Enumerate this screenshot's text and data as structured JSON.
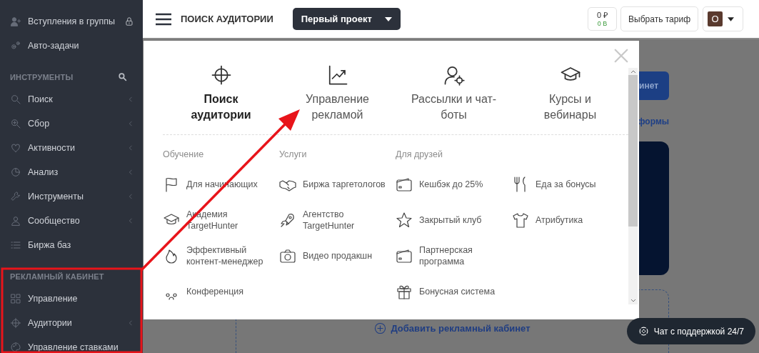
{
  "sidebar": {
    "items": [
      {
        "kind": "link",
        "label": "Вступления в группы",
        "has_submenu": false,
        "locked": true
      },
      {
        "kind": "link",
        "label": "Авто-задачи",
        "has_submenu": false,
        "locked": false
      },
      {
        "kind": "section",
        "label": "ИНСТРУМЕНТЫ",
        "searchable": true
      },
      {
        "kind": "link",
        "label": "Поиск",
        "has_submenu": true,
        "locked": false
      },
      {
        "kind": "link",
        "label": "Сбор",
        "has_submenu": true,
        "locked": false
      },
      {
        "kind": "link",
        "label": "Активности",
        "has_submenu": true,
        "locked": false
      },
      {
        "kind": "link",
        "label": "Анализ",
        "has_submenu": true,
        "locked": false
      },
      {
        "kind": "link",
        "label": "Инструменты",
        "has_submenu": true,
        "locked": false
      },
      {
        "kind": "link",
        "label": "Сообщество",
        "has_submenu": true,
        "locked": false
      },
      {
        "kind": "link",
        "label": "Биржа баз",
        "has_submenu": false,
        "locked": false
      },
      {
        "kind": "section",
        "label": "РЕКЛАМНЫЙ КАБИНЕТ",
        "searchable": false
      },
      {
        "kind": "link",
        "label": "Управление",
        "has_submenu": false,
        "locked": false
      },
      {
        "kind": "link",
        "label": "Аудитории",
        "has_submenu": true,
        "locked": false
      },
      {
        "kind": "link",
        "label": "Управление ставками",
        "has_submenu": false,
        "locked": false
      }
    ]
  },
  "header": {
    "page_title": "ПОИСК АУДИТОРИИ",
    "project": "Первый проект",
    "balance": "0 ₽",
    "bonus": "0 B",
    "tariff_button": "Выбрать тариф",
    "avatar_letter": "О"
  },
  "background": {
    "button_fragment": "инет",
    "link_fragment": "формы",
    "add_button": "Добавить рекламный кабинет"
  },
  "modal": {
    "tiles": [
      {
        "title": "Поиск аудитории",
        "selected": true
      },
      {
        "title": "Управление рекламой",
        "selected": false
      },
      {
        "title": "Рассылки и чат-боты",
        "selected": false
      },
      {
        "title": "Курсы и вебинары",
        "selected": false
      }
    ],
    "columns": [
      {
        "heading": "Обучение",
        "items": [
          "Для начинающих",
          "Академия TargetHunter",
          "Эффективный контент-менеджер",
          "Конференция"
        ]
      },
      {
        "heading": "Услуги",
        "items": [
          "Биржа таргетологов",
          "Агентство TargetHunter",
          "Видео продакшн"
        ]
      },
      {
        "heading": "Для друзей",
        "items": [
          "Кешбэк до 25%",
          "Закрытый клуб",
          "Партнерская программа",
          "Бонусная система"
        ]
      },
      {
        "items": [
          "Еда за бонусы",
          "Атрибутика"
        ]
      }
    ]
  },
  "chat_button": "Чат с поддержкой 24/7",
  "annotations": {
    "highlight_frame": true,
    "arrow": true
  }
}
